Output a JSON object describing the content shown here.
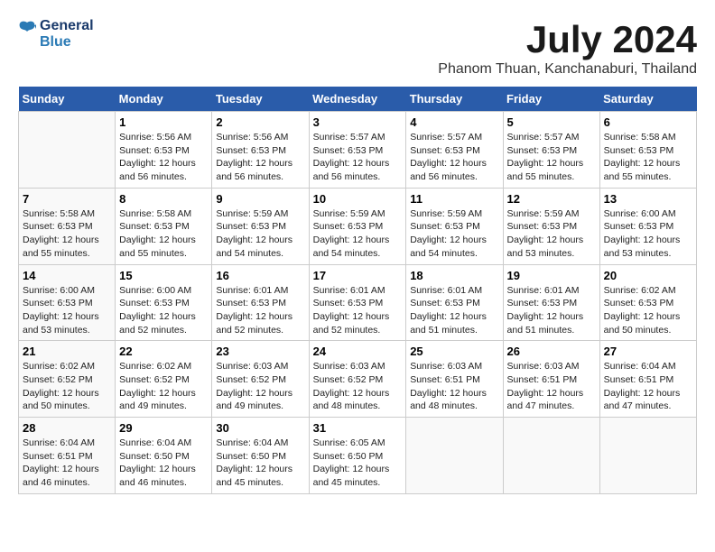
{
  "header": {
    "logo_line1": "General",
    "logo_line2": "Blue",
    "month": "July 2024",
    "location": "Phanom Thuan, Kanchanaburi, Thailand"
  },
  "weekdays": [
    "Sunday",
    "Monday",
    "Tuesday",
    "Wednesday",
    "Thursday",
    "Friday",
    "Saturday"
  ],
  "weeks": [
    [
      {
        "day": "",
        "info": ""
      },
      {
        "day": "1",
        "info": "Sunrise: 5:56 AM\nSunset: 6:53 PM\nDaylight: 12 hours\nand 56 minutes."
      },
      {
        "day": "2",
        "info": "Sunrise: 5:56 AM\nSunset: 6:53 PM\nDaylight: 12 hours\nand 56 minutes."
      },
      {
        "day": "3",
        "info": "Sunrise: 5:57 AM\nSunset: 6:53 PM\nDaylight: 12 hours\nand 56 minutes."
      },
      {
        "day": "4",
        "info": "Sunrise: 5:57 AM\nSunset: 6:53 PM\nDaylight: 12 hours\nand 56 minutes."
      },
      {
        "day": "5",
        "info": "Sunrise: 5:57 AM\nSunset: 6:53 PM\nDaylight: 12 hours\nand 55 minutes."
      },
      {
        "day": "6",
        "info": "Sunrise: 5:58 AM\nSunset: 6:53 PM\nDaylight: 12 hours\nand 55 minutes."
      }
    ],
    [
      {
        "day": "7",
        "info": "Sunrise: 5:58 AM\nSunset: 6:53 PM\nDaylight: 12 hours\nand 55 minutes."
      },
      {
        "day": "8",
        "info": "Sunrise: 5:58 AM\nSunset: 6:53 PM\nDaylight: 12 hours\nand 55 minutes."
      },
      {
        "day": "9",
        "info": "Sunrise: 5:59 AM\nSunset: 6:53 PM\nDaylight: 12 hours\nand 54 minutes."
      },
      {
        "day": "10",
        "info": "Sunrise: 5:59 AM\nSunset: 6:53 PM\nDaylight: 12 hours\nand 54 minutes."
      },
      {
        "day": "11",
        "info": "Sunrise: 5:59 AM\nSunset: 6:53 PM\nDaylight: 12 hours\nand 54 minutes."
      },
      {
        "day": "12",
        "info": "Sunrise: 5:59 AM\nSunset: 6:53 PM\nDaylight: 12 hours\nand 53 minutes."
      },
      {
        "day": "13",
        "info": "Sunrise: 6:00 AM\nSunset: 6:53 PM\nDaylight: 12 hours\nand 53 minutes."
      }
    ],
    [
      {
        "day": "14",
        "info": "Sunrise: 6:00 AM\nSunset: 6:53 PM\nDaylight: 12 hours\nand 53 minutes."
      },
      {
        "day": "15",
        "info": "Sunrise: 6:00 AM\nSunset: 6:53 PM\nDaylight: 12 hours\nand 52 minutes."
      },
      {
        "day": "16",
        "info": "Sunrise: 6:01 AM\nSunset: 6:53 PM\nDaylight: 12 hours\nand 52 minutes."
      },
      {
        "day": "17",
        "info": "Sunrise: 6:01 AM\nSunset: 6:53 PM\nDaylight: 12 hours\nand 52 minutes."
      },
      {
        "day": "18",
        "info": "Sunrise: 6:01 AM\nSunset: 6:53 PM\nDaylight: 12 hours\nand 51 minutes."
      },
      {
        "day": "19",
        "info": "Sunrise: 6:01 AM\nSunset: 6:53 PM\nDaylight: 12 hours\nand 51 minutes."
      },
      {
        "day": "20",
        "info": "Sunrise: 6:02 AM\nSunset: 6:53 PM\nDaylight: 12 hours\nand 50 minutes."
      }
    ],
    [
      {
        "day": "21",
        "info": "Sunrise: 6:02 AM\nSunset: 6:52 PM\nDaylight: 12 hours\nand 50 minutes."
      },
      {
        "day": "22",
        "info": "Sunrise: 6:02 AM\nSunset: 6:52 PM\nDaylight: 12 hours\nand 49 minutes."
      },
      {
        "day": "23",
        "info": "Sunrise: 6:03 AM\nSunset: 6:52 PM\nDaylight: 12 hours\nand 49 minutes."
      },
      {
        "day": "24",
        "info": "Sunrise: 6:03 AM\nSunset: 6:52 PM\nDaylight: 12 hours\nand 48 minutes."
      },
      {
        "day": "25",
        "info": "Sunrise: 6:03 AM\nSunset: 6:51 PM\nDaylight: 12 hours\nand 48 minutes."
      },
      {
        "day": "26",
        "info": "Sunrise: 6:03 AM\nSunset: 6:51 PM\nDaylight: 12 hours\nand 47 minutes."
      },
      {
        "day": "27",
        "info": "Sunrise: 6:04 AM\nSunset: 6:51 PM\nDaylight: 12 hours\nand 47 minutes."
      }
    ],
    [
      {
        "day": "28",
        "info": "Sunrise: 6:04 AM\nSunset: 6:51 PM\nDaylight: 12 hours\nand 46 minutes."
      },
      {
        "day": "29",
        "info": "Sunrise: 6:04 AM\nSunset: 6:50 PM\nDaylight: 12 hours\nand 46 minutes."
      },
      {
        "day": "30",
        "info": "Sunrise: 6:04 AM\nSunset: 6:50 PM\nDaylight: 12 hours\nand 45 minutes."
      },
      {
        "day": "31",
        "info": "Sunrise: 6:05 AM\nSunset: 6:50 PM\nDaylight: 12 hours\nand 45 minutes."
      },
      {
        "day": "",
        "info": ""
      },
      {
        "day": "",
        "info": ""
      },
      {
        "day": "",
        "info": ""
      }
    ]
  ]
}
